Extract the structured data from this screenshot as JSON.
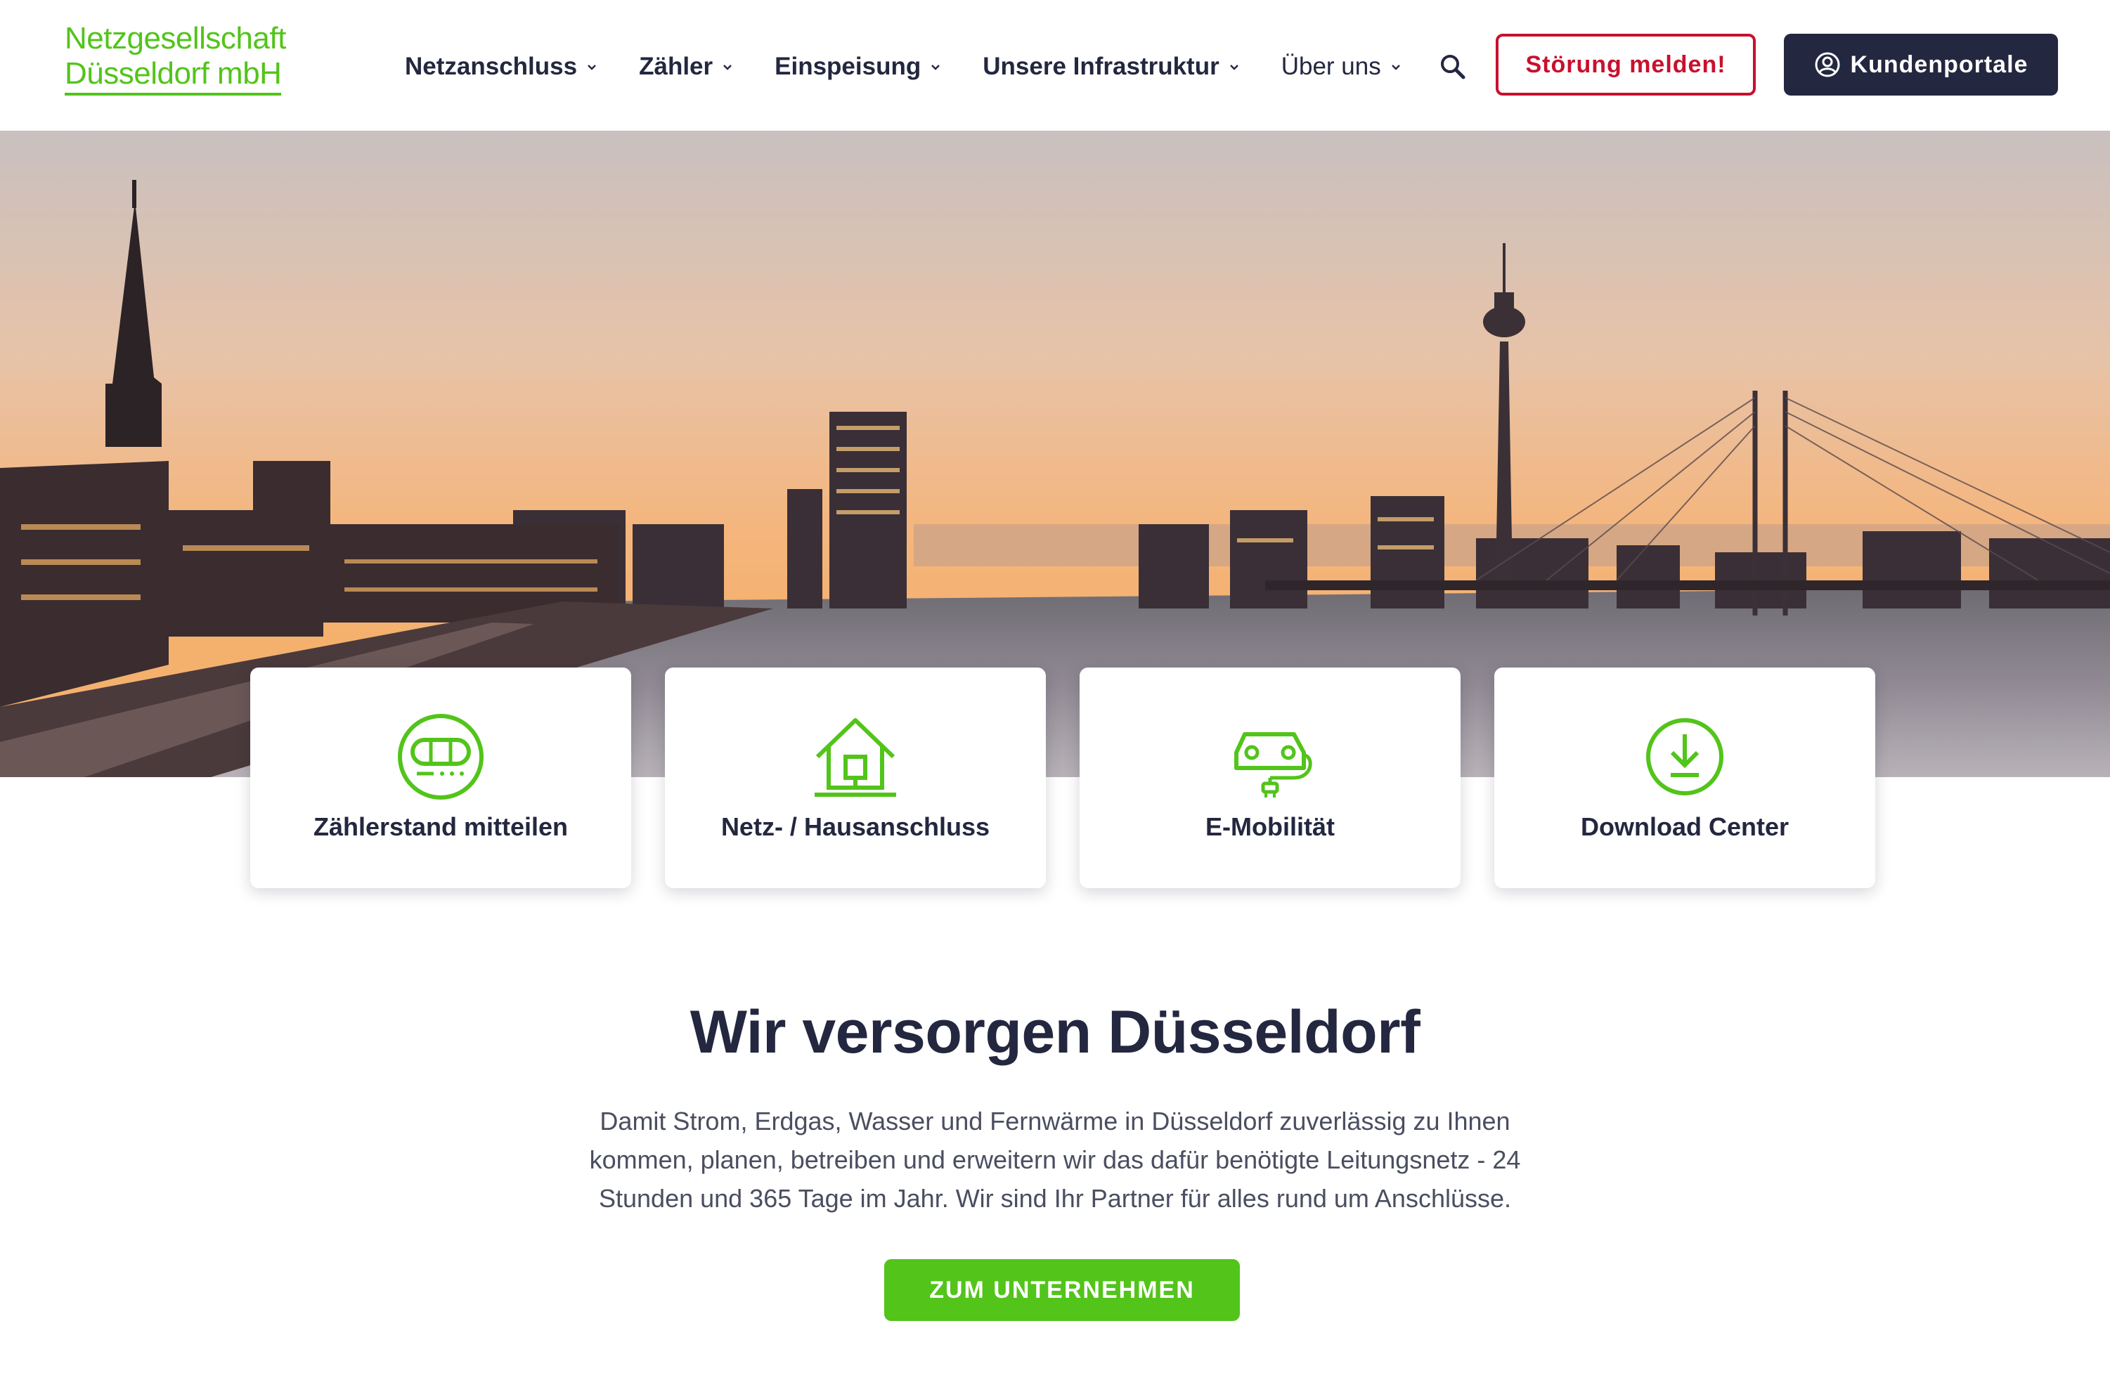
{
  "brand": {
    "logo_line1": "Netzgesellschaft",
    "logo_line2": "Düsseldorf mbH",
    "accent_color": "#52c41a",
    "dark_color": "#23273f",
    "alert_color": "#c8102e"
  },
  "nav": {
    "items": [
      {
        "label": "Netzanschluss",
        "icon": "chevron-down-icon"
      },
      {
        "label": "Zähler",
        "icon": "chevron-down-icon"
      },
      {
        "label": "Einspeisung",
        "icon": "chevron-down-icon"
      },
      {
        "label": "Unsere Infrastruktur",
        "icon": "chevron-down-icon"
      },
      {
        "label": "Über uns",
        "icon": "chevron-down-icon"
      }
    ],
    "search_icon": "search-icon"
  },
  "header": {
    "stoerung_label": "Störung melden!",
    "portal_label": "Kundenportale",
    "portal_icon": "user-circle-icon"
  },
  "cards": [
    {
      "label": "Zählerstand mitteilen",
      "icon": "meter-icon"
    },
    {
      "label": "Netz- / Hausanschluss",
      "icon": "house-icon"
    },
    {
      "label": "E-Mobilität",
      "icon": "e-car-icon"
    },
    {
      "label": "Download Center",
      "icon": "download-icon"
    }
  ],
  "intro": {
    "title": "Wir versorgen Düsseldorf",
    "text": "Damit Strom, Erdgas, Wasser und Fernwärme in Düsseldorf zuverlässig zu Ihnen kommen, planen, betreiben und erweitern wir das dafür benötigte Leitungsnetz - 24 Stunden und 365 Tage im Jahr. Wir sind Ihr Partner für alles rund um Anschlüsse.",
    "cta_label": "ZUM UNTERNEHMEN"
  }
}
